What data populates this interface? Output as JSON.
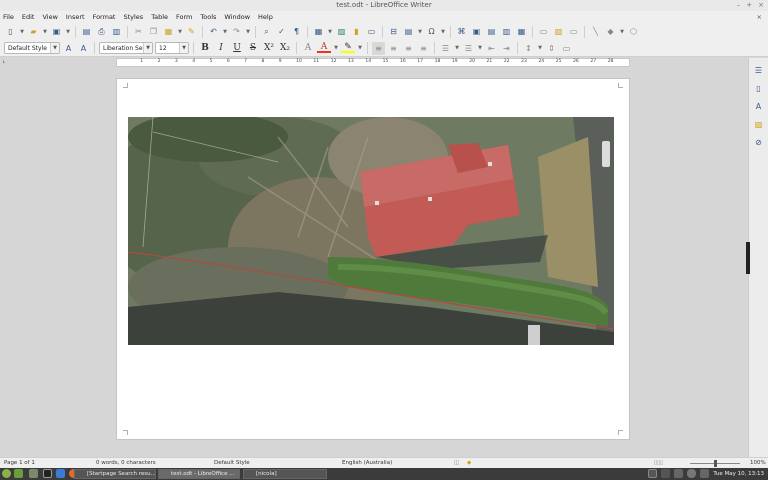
{
  "window": {
    "title": "test.odt - LibreOffice Writer"
  },
  "menu": [
    "File",
    "Edit",
    "View",
    "Insert",
    "Format",
    "Styles",
    "Table",
    "Form",
    "Tools",
    "Window",
    "Help"
  ],
  "toolbar": {
    "paragraph_style": "Default Style",
    "font_name": "Liberation Se",
    "font_size": "12"
  },
  "ruler": {
    "numbers": [
      "1",
      "2",
      "3",
      "4",
      "5",
      "6",
      "7",
      "8",
      "9",
      "10",
      "11",
      "12",
      "13",
      "14",
      "15",
      "16",
      "17",
      "18",
      "19",
      "20",
      "21",
      "22",
      "23",
      "24",
      "25",
      "26",
      "27",
      "28"
    ]
  },
  "status": {
    "page": "Page 1 of 1",
    "words": "0 words, 0 characters",
    "style": "Default Style",
    "language": "English (Australia)",
    "zoom": "100%"
  },
  "taskbar": {
    "tasks": [
      "[Startpage Search resu...",
      "test.odt - LibreOffice ...",
      "[nicola]"
    ],
    "clock": "Tue May 10, 13:13"
  }
}
